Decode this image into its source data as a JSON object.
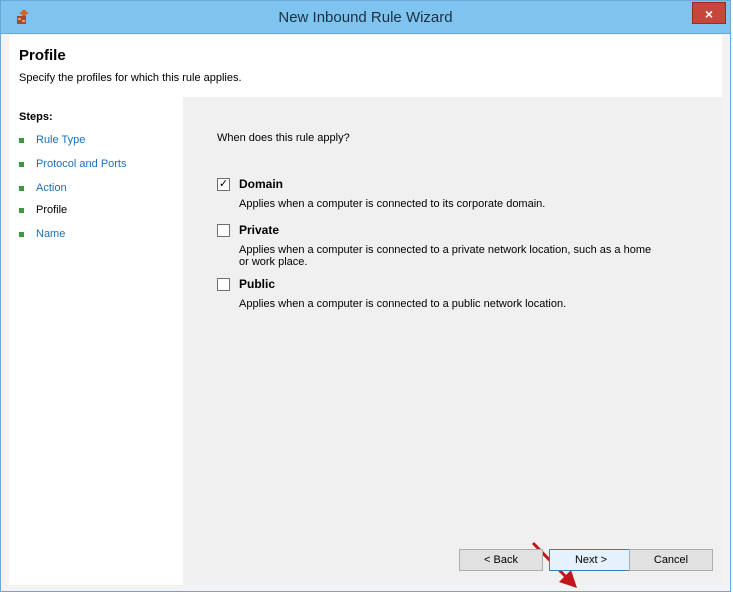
{
  "window": {
    "title": "New Inbound Rule Wizard",
    "close_label": "×"
  },
  "header": {
    "title": "Profile",
    "subtitle": "Specify the profiles for which this rule applies."
  },
  "steps": {
    "heading": "Steps:",
    "items": [
      {
        "label": "Rule Type",
        "current": false
      },
      {
        "label": "Protocol and Ports",
        "current": false
      },
      {
        "label": "Action",
        "current": false
      },
      {
        "label": "Profile",
        "current": true
      },
      {
        "label": "Name",
        "current": false
      }
    ]
  },
  "main": {
    "question": "When does this rule apply?",
    "options": [
      {
        "label": "Domain",
        "checked": true,
        "checkmark": "✓",
        "description": "Applies when a computer is connected to its corporate domain."
      },
      {
        "label": "Private",
        "checked": false,
        "checkmark": "",
        "description": "Applies when a computer is connected to a private network location, such as a home or work place."
      },
      {
        "label": "Public",
        "checked": false,
        "checkmark": "",
        "description": "Applies when a computer is connected to a public network location."
      }
    ]
  },
  "buttons": {
    "back": "< Back",
    "next": "Next >",
    "cancel": "Cancel"
  },
  "colors": {
    "titlebar": "#7fc4ee",
    "close": "#c7463c",
    "link": "#1a6fbf",
    "step_bullet": "#3a9a3a",
    "arrow": "#c0161b"
  }
}
